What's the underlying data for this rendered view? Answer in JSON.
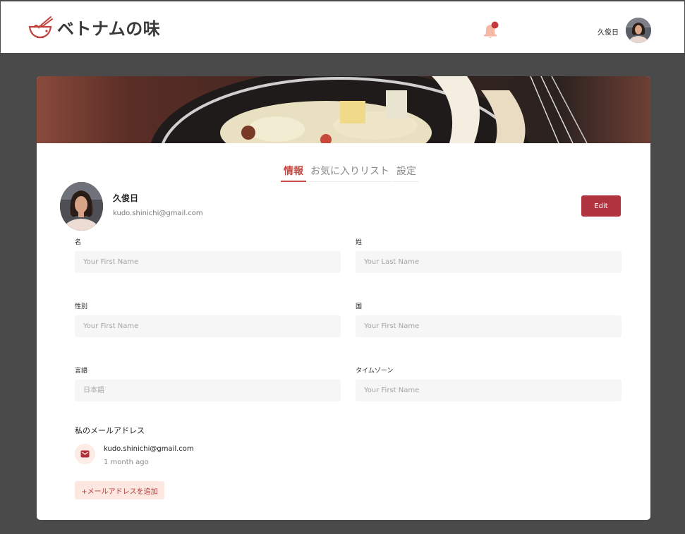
{
  "header": {
    "brand": "ベトナムの味",
    "user_name": "久俊日",
    "logo_icon": "noodle-bowl-icon",
    "bell_icon": "bell-icon",
    "accent": "#b03440"
  },
  "tabs": [
    {
      "label": "情報",
      "active": true
    },
    {
      "label": "お気に入りリスト",
      "active": false
    },
    {
      "label": "設定",
      "active": false
    }
  ],
  "profile": {
    "name": "久俊日",
    "email": "kudo.shinichi@gmail.com",
    "edit_label": "Edit"
  },
  "form": {
    "first_name": {
      "label": "名",
      "placeholder": "Your First Name",
      "value": ""
    },
    "last_name": {
      "label": "姓",
      "placeholder": "Your Last Name",
      "value": ""
    },
    "gender": {
      "label": "性別",
      "placeholder": "Your First Name",
      "value": ""
    },
    "country": {
      "label": "国",
      "placeholder": "Your First Name",
      "value": ""
    },
    "language": {
      "label": "言語",
      "placeholder": "日本語",
      "value": ""
    },
    "timezone": {
      "label": "タイムゾーン",
      "placeholder": "Your First Name",
      "value": ""
    }
  },
  "emails": {
    "title": "私のメールアドレス",
    "items": [
      {
        "email": "kudo.shinichi@gmail.com",
        "time": "1 month ago",
        "icon": "mail-icon"
      }
    ],
    "add_label": "+メールアドレスを追加"
  }
}
